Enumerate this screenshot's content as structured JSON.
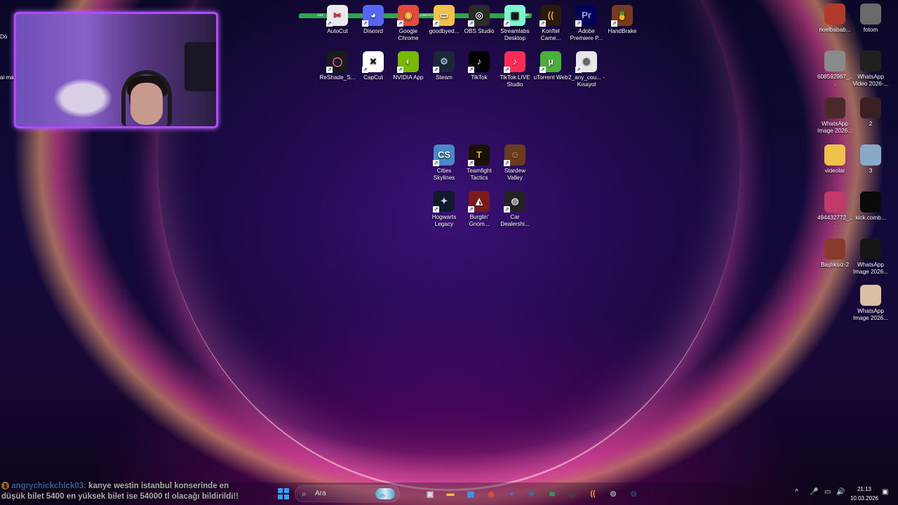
{
  "desktop": {
    "top_row": [
      {
        "label": "AutoCut",
        "color": "#e9e9ef",
        "glyph": "✂",
        "glyph_color": "#d22"
      },
      {
        "label": "Discord",
        "color": "#5865f2",
        "glyph": "◕",
        "glyph_color": "#fff"
      },
      {
        "label": "Google Chrome",
        "color": "#e24a3b",
        "glyph": "◉",
        "glyph_color": "#fbd043"
      },
      {
        "label": "goodbyed...",
        "color": "#f0c24a",
        "glyph": "▭",
        "glyph_color": "#fff"
      },
      {
        "label": "OBS Studio",
        "color": "#2b2b2b",
        "glyph": "◎",
        "glyph_color": "#ddd"
      },
      {
        "label": "Streamlabs Desktop",
        "color": "#80f5d2",
        "glyph": "▣",
        "glyph_color": "#111"
      },
      {
        "label": "Konftel Came...",
        "color": "#2a1a0e",
        "glyph": "((",
        "glyph_color": "#ff9a2a"
      },
      {
        "label": "Adobe Premiere P...",
        "color": "#00005b",
        "glyph": "Pr",
        "glyph_color": "#9b9bff"
      },
      {
        "label": "HandBrake",
        "color": "#7a3a20",
        "glyph": "🍍",
        "glyph_color": "#f6c23a"
      }
    ],
    "second_row": [
      {
        "label": "ReShade_S...",
        "color": "#1a1a1a",
        "glyph": "◯",
        "glyph_color": "#ff6ad5"
      },
      {
        "label": "CapCut",
        "color": "#ffffff",
        "glyph": "✕",
        "glyph_color": "#000"
      },
      {
        "label": "NVIDIA App",
        "color": "#76b900",
        "glyph": "◐",
        "glyph_color": "#fff"
      },
      {
        "label": "Steam",
        "color": "#1b2838",
        "glyph": "⚙",
        "glyph_color": "#9fc6e0"
      },
      {
        "label": "TikTok",
        "color": "#000000",
        "glyph": "♪",
        "glyph_color": "#fff"
      },
      {
        "label": "TikTok LIVE Studio",
        "color": "#fe2c55",
        "glyph": "♪",
        "glyph_color": "#fff"
      },
      {
        "label": "uTorrent Web",
        "color": "#4bb03a",
        "glyph": "µ",
        "glyph_color": "#fff"
      },
      {
        "label": "2_any_cou... - Kısayol",
        "color": "#e8e8e8",
        "glyph": "⚙",
        "glyph_color": "#666"
      }
    ],
    "games_row1": [
      {
        "label": "Cities Skylines",
        "color": "#4a88c8",
        "glyph": "CS",
        "glyph_color": "#fff"
      },
      {
        "label": "Teamfight Tactics",
        "color": "#1a1200",
        "glyph": "T",
        "glyph_color": "#e8b923"
      },
      {
        "label": "Stardew Valley",
        "color": "#6a3b1f",
        "glyph": "☺",
        "glyph_color": "#f2b46a"
      }
    ],
    "games_row2": [
      {
        "label": "Hogwarts Legacy",
        "color": "#0f1a2a",
        "glyph": "✦",
        "glyph_color": "#c7d7ff"
      },
      {
        "label": "Burglin' Gnom...",
        "color": "#7a1a1a",
        "glyph": "◭",
        "glyph_color": "#fff"
      },
      {
        "label": "Car Dealershi...",
        "color": "#222",
        "glyph": "◍",
        "glyph_color": "#ccc"
      }
    ],
    "right_column": [
      {
        "label": "noelbabab...",
        "color": "#b23a2a"
      },
      {
        "label": "fotom",
        "color": "#6a6a6a"
      },
      {
        "label": "608592967_...",
        "color": "#8a8a8a"
      },
      {
        "label": "WhatsApp Video 2026-...",
        "color": "#202020"
      },
      {
        "label": "WhatsApp Image 2026...",
        "color": "#4a2a2a"
      },
      {
        "label": "2",
        "color": "#3a2020"
      },
      {
        "label": "videolar",
        "color": "#f0c24a"
      },
      {
        "label": "3",
        "color": "#8aa8c8"
      },
      {
        "label": "494432772_...",
        "color": "#c23a6a"
      },
      {
        "label": "kick.comb...",
        "color": "#0a0a0a"
      },
      {
        "label": "Başlıksız-2",
        "color": "#8a3a2a"
      },
      {
        "label": "WhatsApp Image 2026...",
        "color": "#151515"
      },
      {
        "label": "WhatsApp Image 2026...",
        "color": "#d8c0a0"
      }
    ],
    "left_fragments": [
      "Dö",
      "ai ma"
    ]
  },
  "stream_overlay": {
    "follow_bar_left": "214",
    "follow_bar_center": "FOLLOWERS",
    "follow_bar_right": "300"
  },
  "chat": {
    "badge": "1",
    "username": "angrychickchick03:",
    "message": "kanye westin istanbul konserinde en düşük bilet 5400 en yüksek bilet ise 54000 tl olacağı bildirildi!!"
  },
  "taskbar": {
    "search_placeholder": "Ara",
    "pinned": [
      {
        "name": "widgets",
        "color": "#7ab8d8",
        "glyph": "☁"
      },
      {
        "name": "task-view",
        "color": "#ddd",
        "glyph": "▣"
      },
      {
        "name": "file-explorer",
        "color": "#f0c24a",
        "glyph": "▬"
      },
      {
        "name": "ms-store",
        "color": "#2fa0ff",
        "glyph": "▦"
      },
      {
        "name": "chrome",
        "color": "#e24a3b",
        "glyph": "◉"
      },
      {
        "name": "discord",
        "color": "#5865f2",
        "glyph": "◕"
      },
      {
        "name": "app-blue",
        "color": "#3a6ea5",
        "glyph": "❖"
      },
      {
        "name": "spotify",
        "color": "#1db954",
        "glyph": "≋"
      },
      {
        "name": "obs",
        "color": "#444",
        "glyph": "◎"
      },
      {
        "name": "konftel",
        "color": "#ff9a2a",
        "glyph": "(("
      },
      {
        "name": "settings",
        "color": "#9aa0a8",
        "glyph": "⚙"
      },
      {
        "name": "steam",
        "color": "#2a4a6a",
        "glyph": "⚙"
      }
    ],
    "tray_icons": [
      "^",
      "🎤",
      "▭",
      "🔊"
    ],
    "clock_time": "21:13",
    "clock_date": "10.03.2026"
  }
}
